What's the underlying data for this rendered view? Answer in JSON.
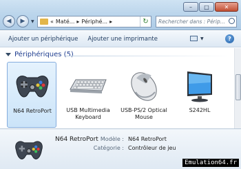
{
  "window": {
    "minimize_glyph": "–",
    "maximize_glyph": "□",
    "close_glyph": "✕"
  },
  "nav": {
    "back_glyph": "◀",
    "forward_glyph": "▶",
    "history_glyph": "▼"
  },
  "address": {
    "overflow": "«",
    "crumb_1": "Maté...",
    "crumb_2": "Périphé...",
    "separator": "▸",
    "refresh_glyph": "↻"
  },
  "search": {
    "placeholder": "Rechercher dans : Périp..."
  },
  "commandbar": {
    "add_device": "Ajouter un périphérique",
    "add_printer": "Ajouter une imprimante",
    "help": "?"
  },
  "group": {
    "title": "Périphériques (5)"
  },
  "devices": [
    {
      "label": "N64 RetroPort",
      "icon": "gamepad-icon",
      "selected": true
    },
    {
      "label": "USB Multimedia Keyboard",
      "icon": "keyboard-icon",
      "selected": false
    },
    {
      "label": "USB-PS/2 Optical Mouse",
      "icon": "mouse-icon",
      "selected": false
    },
    {
      "label": "S242HL",
      "icon": "monitor-icon",
      "selected": false
    }
  ],
  "details": {
    "name": "N64 RetroPort",
    "model_label": "Modèle :",
    "model_value": "N64 RetroPort",
    "category_label": "Catégorie :",
    "category_value": "Contrôleur de jeu"
  },
  "watermark": "Emulation64.fr",
  "colors": {
    "accent": "#1e3d8f",
    "selection": "#cbe4f9"
  }
}
